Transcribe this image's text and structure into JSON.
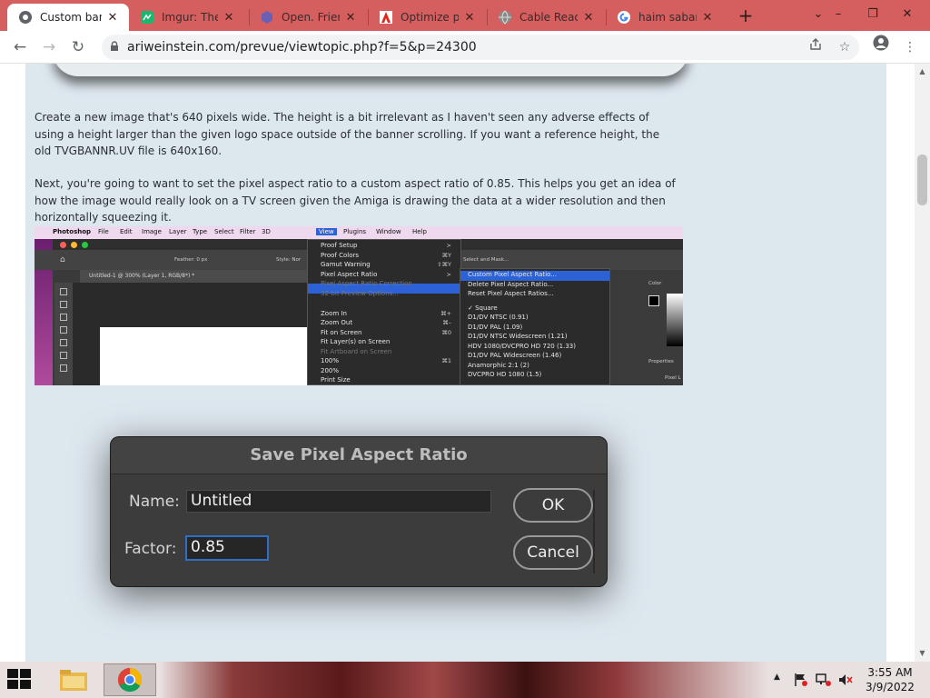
{
  "browser": {
    "tabs": [
      {
        "label": "Custom banner",
        "favicon": "chrome-icon",
        "active": true
      },
      {
        "label": "Imgur: The magic",
        "favicon": "imgur-icon",
        "active": false
      },
      {
        "label": "Open. Friendly",
        "favicon": "hexagon-icon",
        "active": false
      },
      {
        "label": "Optimize performance",
        "favicon": "adobe-icon",
        "active": false
      },
      {
        "label": "Cable Ready",
        "favicon": "globe-icon",
        "active": false
      },
      {
        "label": "haim saban",
        "favicon": "google-icon",
        "active": false
      }
    ],
    "new_tab_label": "+",
    "controls": {
      "dropdown": "⌄",
      "minimize": "–",
      "restore": "❐",
      "close": "✕"
    },
    "url": "ariweinstein.com/prevue/viewtopic.php?f=5&p=24300"
  },
  "post": {
    "para1": "Create a new image that's 640 pixels wide. The height is a bit irrelevant as I haven't seen any adverse effects of using a height larger than the given logo space outside of the banner scrolling. If you want a reference height, the old TVGBANNR.UV file is 640x160.",
    "para2": "Next, you're going to want to set the pixel aspect ratio to a custom aspect ratio of 0.85. This helps you get an idea of how the image would really look on a TV screen given the Amiga is drawing the data at a wider resolution and then horizontally squeezing it."
  },
  "photoshop": {
    "menubar": [
      "Photoshop",
      "File",
      "Edit",
      "Image",
      "Layer",
      "Type",
      "Select",
      "Filter",
      "3D",
      "View",
      "Plugins",
      "Window",
      "Help"
    ],
    "doc_tab": "Untitled-1 @ 300% (Layer 1, RGB/8*) *",
    "options_feather": "Feather: 0 px",
    "options_style": "Style: Nor",
    "options_select_mask": "Select and Mask...",
    "view_menu": [
      {
        "label": "Proof Setup",
        "shortcut": ">",
        "disabled": false
      },
      {
        "label": "Proof Colors",
        "shortcut": "⌘Y",
        "disabled": false
      },
      {
        "label": "Gamut Warning",
        "shortcut": "⇧⌘Y",
        "disabled": false
      },
      {
        "label": "Pixel Aspect Ratio",
        "shortcut": ">",
        "disabled": false,
        "highlighted": true
      },
      {
        "label": "Pixel Aspect Ratio Correction",
        "shortcut": "",
        "disabled": true
      },
      {
        "label": "32-bit Preview Options...",
        "shortcut": "",
        "disabled": true
      },
      {
        "label": "Zoom In",
        "shortcut": "⌘+",
        "disabled": false
      },
      {
        "label": "Zoom Out",
        "shortcut": "⌘–",
        "disabled": false
      },
      {
        "label": "Fit on Screen",
        "shortcut": "⌘0",
        "disabled": false
      },
      {
        "label": "Fit Layer(s) on Screen",
        "shortcut": "",
        "disabled": false
      },
      {
        "label": "Fit Artboard on Screen",
        "shortcut": "",
        "disabled": true
      },
      {
        "label": "100%",
        "shortcut": "⌘1",
        "disabled": false
      },
      {
        "label": "200%",
        "shortcut": "",
        "disabled": false
      },
      {
        "label": "Print Size",
        "shortcut": "",
        "disabled": false
      }
    ],
    "submenu": [
      {
        "label": "Custom Pixel Aspect Ratio...",
        "highlighted": true
      },
      {
        "label": "Delete Pixel Aspect Ratio..."
      },
      {
        "label": "Reset Pixel Aspect Ratios..."
      },
      {
        "label": "✓ Square"
      },
      {
        "label": "D1/DV NTSC (0.91)"
      },
      {
        "label": "D1/DV PAL (1.09)"
      },
      {
        "label": "D1/DV NTSC Widescreen (1.21)"
      },
      {
        "label": "HDV 1080/DVCPRO HD 720 (1.33)"
      },
      {
        "label": "D1/DV PAL Widescreen (1.46)"
      },
      {
        "label": "Anamorphic 2:1 (2)"
      },
      {
        "label": "DVCPRO HD 1080 (1.5)"
      }
    ],
    "panel_color": "Color",
    "panel_properties": "Properties",
    "panel_pixel": "Pixel L"
  },
  "dialog": {
    "title": "Save Pixel Aspect Ratio",
    "name_label": "Name:",
    "name_value": "Untitled",
    "factor_label": "Factor:",
    "factor_value": "0.85",
    "ok_label": "OK",
    "cancel_label": "Cancel"
  },
  "taskbar": {
    "time": "3:55 AM",
    "date": "3/9/2022",
    "tray_chevron": "▲"
  },
  "colors": {
    "tab_strip": "#d55f5f",
    "post_bg": "#dde7ee",
    "selection": "#2d62d6"
  }
}
